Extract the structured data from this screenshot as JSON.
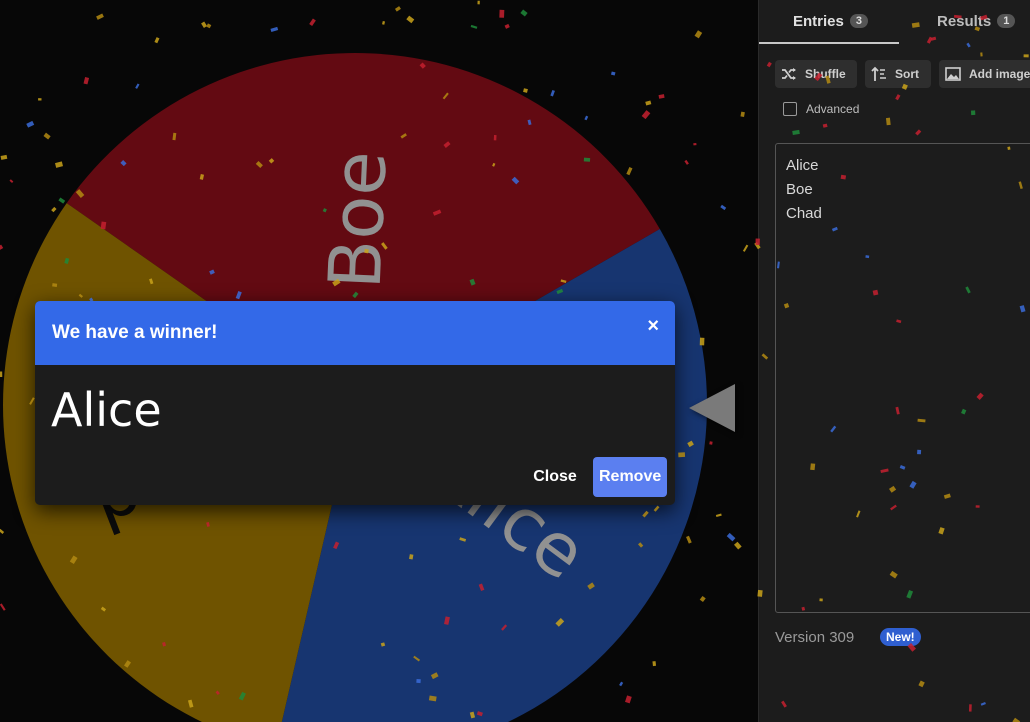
{
  "wheel": {
    "segments": [
      {
        "label": "Boe",
        "color": "#8a0e1a"
      },
      {
        "label": "Alice",
        "color": "#214a9c"
      },
      {
        "label": "Chad",
        "color": "#9a7300"
      }
    ]
  },
  "dialog": {
    "title": "We have a winner!",
    "close_x": "×",
    "winner": "Alice",
    "close_label": "Close",
    "remove_label": "Remove"
  },
  "tabs": [
    {
      "label": "Entries",
      "count": "3"
    },
    {
      "label": "Results",
      "count": "1"
    }
  ],
  "toolbar": {
    "shuffle_label": "Shuffle",
    "sort_label": "Sort",
    "add_image_label": "Add image",
    "shuffle_icon": "shuffle-icon",
    "sort_icon": "sort-icon",
    "image_icon": "image-icon"
  },
  "advanced_label": "Advanced",
  "entries": [
    "Alice",
    "Boe",
    "Chad"
  ],
  "footer": {
    "version": "Version 309",
    "new_badge": "New!"
  },
  "colors": {
    "accent": "#3369e8",
    "remove_button": "#5b7ff0",
    "panel_bg": "#1c1c1c"
  }
}
